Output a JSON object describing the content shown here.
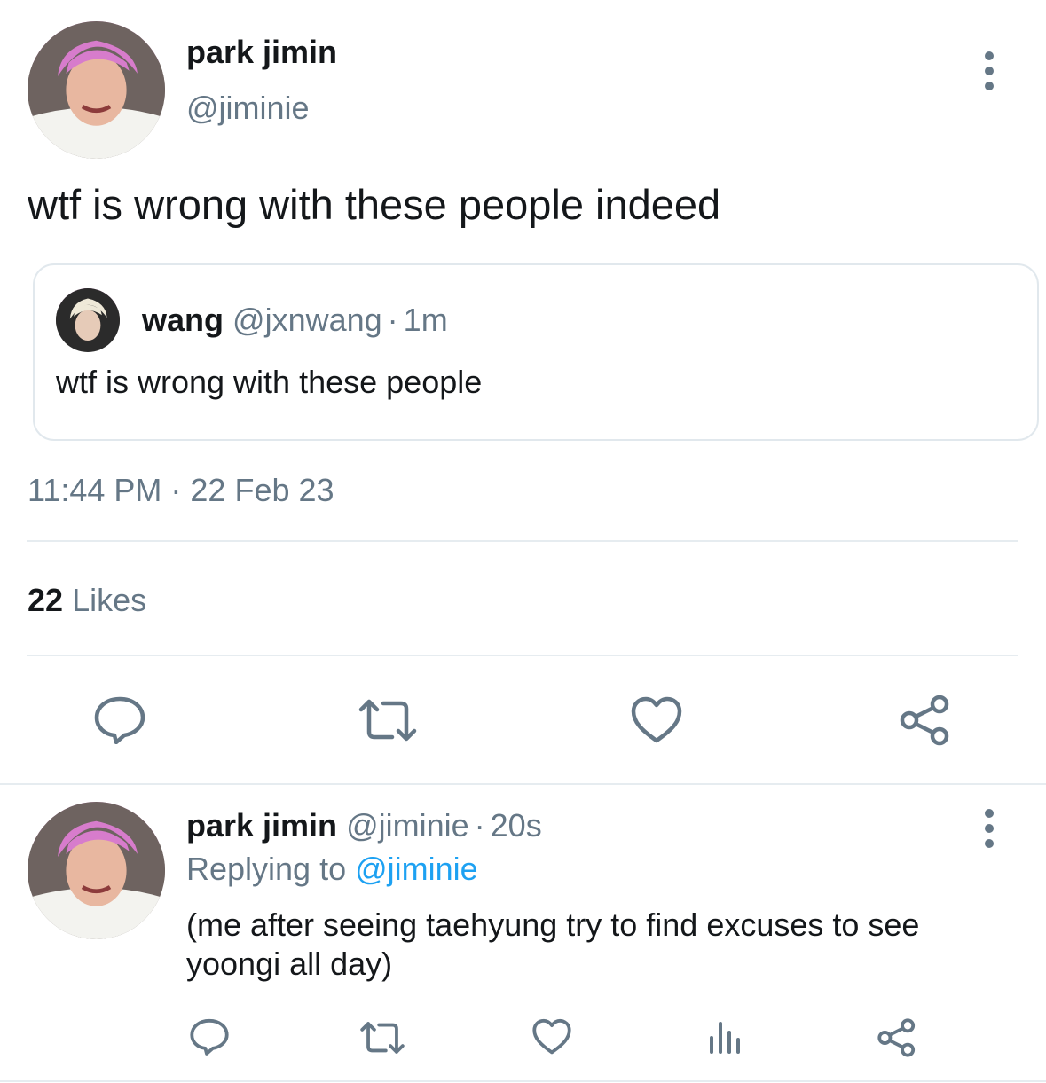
{
  "main_tweet": {
    "author_name": "park jimin",
    "author_handle": "@jiminie",
    "text": "wtf is wrong with these people indeed",
    "quote": {
      "author_name": "wang",
      "author_handle": "@jxnwang",
      "separator": "·",
      "time": "1m",
      "text": "wtf is wrong with these people"
    },
    "timestamp": "11:44 PM · 22 Feb 23",
    "likes_count": "22",
    "likes_label": "Likes",
    "actions": [
      "reply-icon",
      "retweet-icon",
      "like-icon",
      "share-icon"
    ]
  },
  "reply_tweet": {
    "author_name": "park jimin",
    "author_handle": "@jiminie",
    "separator": "·",
    "time": "20s",
    "replying_prefix": "Replying to",
    "replying_handle": "@jiminie",
    "text_line1": "(me after seeing taehyung try to find excuses to see",
    "text_line2": "yoongi all day)",
    "actions": [
      "reply-icon",
      "retweet-icon",
      "like-icon",
      "analytics-icon",
      "share-icon"
    ]
  },
  "colors": {
    "text_primary": "#14171a",
    "text_muted": "#657786",
    "link": "#1da1f2",
    "divider": "#e6ecf0"
  }
}
